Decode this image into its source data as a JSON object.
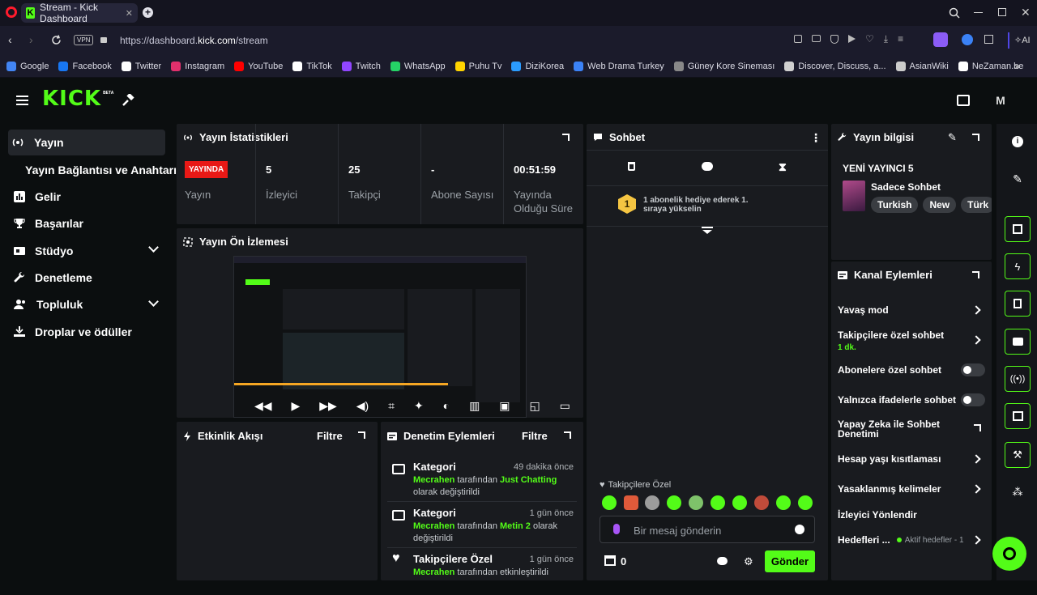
{
  "browser": {
    "tab_title": "Stream - Kick Dashboard",
    "url_prefix": "https://dashboard.",
    "url_domain": "kick.com",
    "url_path": "/stream",
    "vpn_label": "VPN",
    "ai_label": "AI",
    "bookmarks": [
      {
        "label": "Google",
        "color": "#4285f4"
      },
      {
        "label": "Facebook",
        "color": "#1877f2"
      },
      {
        "label": "Twitter",
        "color": "#ffffff"
      },
      {
        "label": "Instagram",
        "color": "#e1306c"
      },
      {
        "label": "YouTube",
        "color": "#ff0000"
      },
      {
        "label": "TikTok",
        "color": "#ffffff"
      },
      {
        "label": "Twitch",
        "color": "#9146ff"
      },
      {
        "label": "WhatsApp",
        "color": "#25d366"
      },
      {
        "label": "Puhu Tv",
        "color": "#ffd400"
      },
      {
        "label": "DiziKorea",
        "color": "#2b9cff"
      },
      {
        "label": "Web Drama Turkey",
        "color": "#3b82f6"
      },
      {
        "label": "Güney Kore Sineması",
        "color": "#888888"
      },
      {
        "label": "Discover, Discuss, a...",
        "color": "#d0d0d0"
      },
      {
        "label": "AsianWiki",
        "color": "#cccccc"
      },
      {
        "label": "NeZaman.be",
        "color": "#ffffff"
      }
    ]
  },
  "header": {
    "logo": "KICK",
    "beta": "BETA"
  },
  "sidebar": {
    "items": [
      {
        "label": "Yayın"
      },
      {
        "label": "Yayın Bağlantısı ve Anahtarı"
      },
      {
        "label": "Gelir"
      },
      {
        "label": "Başarılar"
      },
      {
        "label": "Stüdyo"
      },
      {
        "label": "Denetleme"
      },
      {
        "label": "Topluluk"
      },
      {
        "label": "Droplar ve ödüller"
      }
    ]
  },
  "stats": {
    "title": "Yayın İstatistikleri",
    "live_badge": "YAYINDA",
    "live_label": "Yayın",
    "viewers_value": "5",
    "viewers_label": "İzleyici",
    "followers_value": "25",
    "followers_label": "Takipçi",
    "subs_value": "-",
    "subs_label": "Abone Sayısı",
    "duration_value": "00:51:59",
    "duration_label": "Yayında Olduğu Süre"
  },
  "preview": {
    "title": "Yayın Ön İzlemesi"
  },
  "activity": {
    "title": "Etkinlik Akışı",
    "filter": "Filtre"
  },
  "moderation": {
    "title": "Denetim Eylemleri",
    "filter": "Filtre",
    "rows": [
      {
        "title": "Kategori",
        "time": "49 dakika önce",
        "user": "Mecrahen",
        "mid": " tarafından ",
        "target": "Just Chatting",
        "tail": " olarak değiştirildi"
      },
      {
        "title": "Kategori",
        "time": "1 gün önce",
        "user": "Mecrahen",
        "mid": " tarafından ",
        "target": "Metin 2",
        "tail": " olarak değiştirildi"
      },
      {
        "title": "Takipçilere Özel",
        "time": "1 gün önce",
        "user": "Mecrahen",
        "mid": " tarafından etkinleştirildi",
        "target": "",
        "tail": ""
      }
    ]
  },
  "chat": {
    "title": "Sohbet",
    "gift_message": "1 abonelik hediye ederek 1. sıraya yükselin",
    "gift_rank": "1",
    "followers_only": "Takipçilere Özel",
    "input_placeholder": "Bir mesaj gönderin",
    "count": "0",
    "send": "Gönder"
  },
  "stream_info": {
    "title": "Yayın bilgisi",
    "stream_name": "YENİ YAYINCI 5",
    "category": "Sadece Sohbet",
    "tags": [
      "Turkish",
      "New",
      "Türk"
    ]
  },
  "channel_actions": {
    "title": "Kanal Eylemleri",
    "slow_mode": "Yavaş mod",
    "followers_chat": "Takipçilere özel sohbet",
    "followers_chat_value": "1 dk.",
    "subs_chat": "Abonelere özel sohbet",
    "emotes_chat": "Yalnızca ifadelerle sohbet",
    "ai_moderation": "Yapay Zeka ile Sohbet Denetimi",
    "age_restriction": "Hesap yaşı kısıtlaması",
    "banned_words": "Yasaklanmış kelimeler",
    "viewer_redirect": "İzleyici Yönlendir",
    "goals": "Hedefleri ...",
    "goals_status": "Aktif hedefler - 1"
  },
  "colors": {
    "accent": "#53fc18",
    "live": "#e91916",
    "panel": "#191b1f",
    "background": "#0b0e0f"
  }
}
